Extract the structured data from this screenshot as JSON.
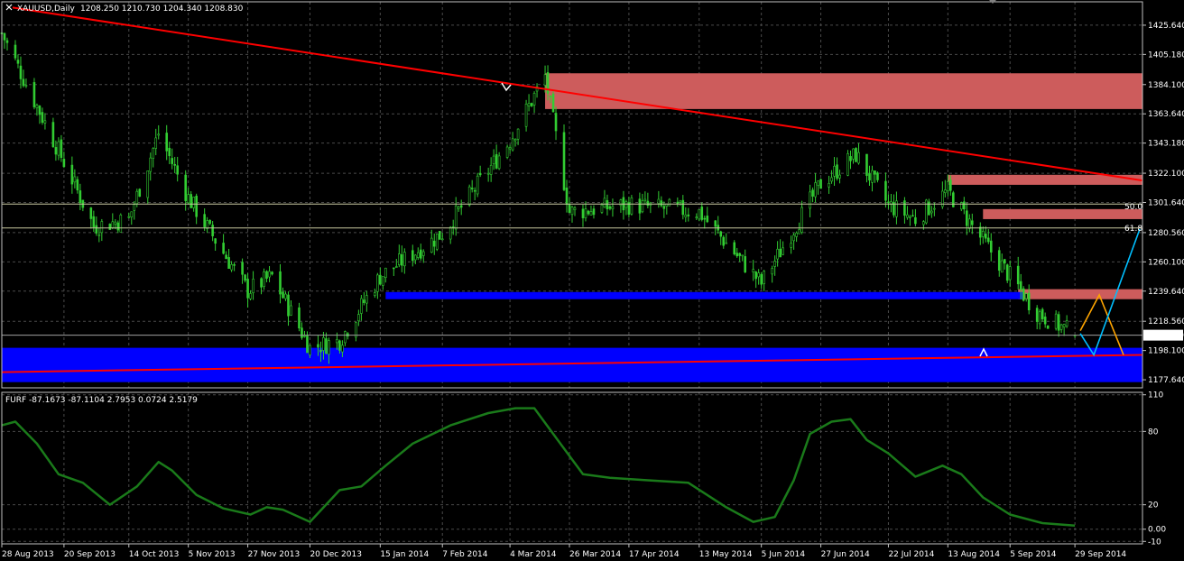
{
  "colors": {
    "background": "#000000",
    "grid": "#4a4a4a",
    "axis": "#c0c0c0",
    "bull_candle": "#32cd32",
    "bear_candle": "#32cd32",
    "oscillator": "#1a7a1a",
    "trendline": "#ff0000",
    "resistance_zone": "#cd5c5c",
    "support_zone": "#0000ff",
    "projection_orange": "#ffa500",
    "projection_cyan": "#00bfff",
    "fib_line": "#c8c8a0"
  },
  "main_panel": {
    "symbol_label": "XAUUSD,Daily",
    "ohlc_label": "1208.250 1210.730 1204.340 1208.830",
    "current_price": "1208.830",
    "fib_50_label": "50.0",
    "fib_618_label": "61.8"
  },
  "indicator_panel": {
    "label": "FURF -87.1673 -87.1104 2.7953 0.0724 2.5179"
  },
  "chart_data": [
    {
      "type": "candlestick",
      "title": "XAUUSD,Daily",
      "ylim": [
        1172,
        1442
      ],
      "y_ticks": [
        "1425.640",
        "1405.180",
        "1384.100",
        "1363.640",
        "1343.180",
        "1322.100",
        "1301.640",
        "1280.560",
        "1260.100",
        "1239.640",
        "1218.560",
        "1198.100",
        "1177.640"
      ],
      "x_ticks": [
        "28 Aug 2013",
        "20 Sep 2013",
        "14 Oct 2013",
        "5 Nov 2013",
        "27 Nov 2013",
        "20 Dec 2013",
        "15 Jan 2014",
        "7 Feb 2014",
        "4 Mar 2014",
        "26 Mar 2014",
        "17 Apr 2014",
        "13 May 2014",
        "5 Jun 2014",
        "27 Jun 2014",
        "22 Jul 2014",
        "13 Aug 2014",
        "5 Sep 2014",
        "29 Sep 2014"
      ],
      "close_path_keypoints": [
        {
          "date": "28 Aug 2013",
          "value": 1420
        },
        {
          "date": "20 Sep 2013",
          "value": 1330
        },
        {
          "date": "1 Oct 2013",
          "value": 1285
        },
        {
          "date": "14 Oct 2013",
          "value": 1290
        },
        {
          "date": "25 Oct 2013",
          "value": 1350
        },
        {
          "date": "5 Nov 2013",
          "value": 1305
        },
        {
          "date": "27 Nov 2013",
          "value": 1240
        },
        {
          "date": "6 Dec 2013",
          "value": 1250
        },
        {
          "date": "20 Dec 2013",
          "value": 1200
        },
        {
          "date": "31 Dec 2013",
          "value": 1205
        },
        {
          "date": "15 Jan 2014",
          "value": 1250
        },
        {
          "date": "7 Feb 2014",
          "value": 1280
        },
        {
          "date": "4 Mar 2014",
          "value": 1345
        },
        {
          "date": "17 Mar 2014",
          "value": 1390
        },
        {
          "date": "26 Mar 2014",
          "value": 1295
        },
        {
          "date": "17 Apr 2014",
          "value": 1300
        },
        {
          "date": "13 May 2014",
          "value": 1295
        },
        {
          "date": "5 Jun 2014",
          "value": 1245
        },
        {
          "date": "27 Jun 2014",
          "value": 1315
        },
        {
          "date": "10 Jul 2014",
          "value": 1335
        },
        {
          "date": "22 Jul 2014",
          "value": 1300
        },
        {
          "date": "1 Aug 2014",
          "value": 1290
        },
        {
          "date": "13 Aug 2014",
          "value": 1310
        },
        {
          "date": "22 Aug 2014",
          "value": 1285
        },
        {
          "date": "5 Sep 2014",
          "value": 1250
        },
        {
          "date": "15 Sep 2014",
          "value": 1225
        },
        {
          "date": "29 Sep 2014",
          "value": 1208.83
        }
      ],
      "annotations": {
        "trendline": [
          {
            "date": "1 Sep 2013",
            "value": 1438
          },
          {
            "date": "24 Oct 2014",
            "value": 1317
          }
        ],
        "support_trendline": [
          {
            "date": "28 Aug 2013",
            "value": 1183
          },
          {
            "date": "24 Oct 2014",
            "value": 1195
          }
        ],
        "resistance_zones": [
          {
            "from": "17 Mar 2014",
            "to": "24 Oct 2014",
            "low": 1367,
            "high": 1392
          },
          {
            "from": "13 Aug 2014",
            "to": "24 Oct 2014",
            "low": 1314,
            "high": 1321
          },
          {
            "from": "26 Aug 2014",
            "to": "24 Oct 2014",
            "low": 1290,
            "high": 1297
          },
          {
            "from": "8 Sep 2014",
            "to": "24 Oct 2014",
            "low": 1234,
            "high": 1241
          }
        ],
        "support_zones": [
          {
            "from": "17 Jan 2014",
            "to": "10 Sep 2014",
            "low": 1234,
            "high": 1239
          },
          {
            "from": "28 Aug 2013",
            "to": "24 Oct 2014",
            "low": 1176,
            "high": 1200
          }
        ],
        "fib_levels": [
          {
            "label": "50.0",
            "value": 1300.5
          },
          {
            "label": "61.8",
            "value": 1283.8
          }
        ],
        "horizontal_lines": [
          1208.83
        ],
        "projection_orange": [
          {
            "date": "1 Oct 2014",
            "value": 1212
          },
          {
            "date": "8 Oct 2014",
            "value": 1237
          },
          {
            "date": "17 Oct 2014",
            "value": 1195
          }
        ],
        "projection_cyan": [
          {
            "date": "1 Oct 2014",
            "value": 1210
          },
          {
            "date": "6 Oct 2014",
            "value": 1195
          },
          {
            "date": "23 Oct 2014",
            "value": 1283
          }
        ]
      }
    },
    {
      "type": "line",
      "title": "FURF",
      "ylim": [
        -12,
        112
      ],
      "y_ticks": [
        "110",
        "80",
        "20",
        "0.00",
        "-10"
      ],
      "series": [
        {
          "name": "FURF",
          "points": [
            {
              "date": "28 Aug 2013",
              "value": 85
            },
            {
              "date": "2 Sep 2013",
              "value": 88
            },
            {
              "date": "10 Sep 2013",
              "value": 70
            },
            {
              "date": "18 Sep 2013",
              "value": 45
            },
            {
              "date": "27 Sep 2013",
              "value": 38
            },
            {
              "date": "7 Oct 2013",
              "value": 20
            },
            {
              "date": "17 Oct 2013",
              "value": 35
            },
            {
              "date": "25 Oct 2013",
              "value": 55
            },
            {
              "date": "30 Oct 2013",
              "value": 48
            },
            {
              "date": "8 Nov 2013",
              "value": 28
            },
            {
              "date": "18 Nov 2013",
              "value": 17
            },
            {
              "date": "28 Nov 2013",
              "value": 12
            },
            {
              "date": "4 Dec 2013",
              "value": 18
            },
            {
              "date": "10 Dec 2013",
              "value": 16
            },
            {
              "date": "20 Dec 2013",
              "value": 6
            },
            {
              "date": "31 Dec 2013",
              "value": 32
            },
            {
              "date": "8 Jan 2014",
              "value": 35
            },
            {
              "date": "17 Jan 2014",
              "value": 52
            },
            {
              "date": "27 Jan 2014",
              "value": 70
            },
            {
              "date": "10 Feb 2014",
              "value": 85
            },
            {
              "date": "24 Feb 2014",
              "value": 95
            },
            {
              "date": "6 Mar 2014",
              "value": 99
            },
            {
              "date": "13 Mar 2014",
              "value": 99
            },
            {
              "date": "21 Mar 2014",
              "value": 75
            },
            {
              "date": "31 Mar 2014",
              "value": 45
            },
            {
              "date": "10 Apr 2014",
              "value": 42
            },
            {
              "date": "24 Apr 2014",
              "value": 40
            },
            {
              "date": "9 May 2014",
              "value": 38
            },
            {
              "date": "23 May 2014",
              "value": 18
            },
            {
              "date": "2 Jun 2014",
              "value": 6
            },
            {
              "date": "10 Jun 2014",
              "value": 10
            },
            {
              "date": "17 Jun 2014",
              "value": 40
            },
            {
              "date": "23 Jun 2014",
              "value": 78
            },
            {
              "date": "1 Jul 2014",
              "value": 88
            },
            {
              "date": "8 Jul 2014",
              "value": 90
            },
            {
              "date": "14 Jul 2014",
              "value": 73
            },
            {
              "date": "22 Jul 2014",
              "value": 62
            },
            {
              "date": "1 Aug 2014",
              "value": 43
            },
            {
              "date": "11 Aug 2014",
              "value": 52
            },
            {
              "date": "18 Aug 2014",
              "value": 45
            },
            {
              "date": "26 Aug 2014",
              "value": 26
            },
            {
              "date": "5 Sep 2014",
              "value": 12
            },
            {
              "date": "17 Sep 2014",
              "value": 5
            },
            {
              "date": "29 Sep 2014",
              "value": 3
            }
          ]
        }
      ]
    }
  ]
}
